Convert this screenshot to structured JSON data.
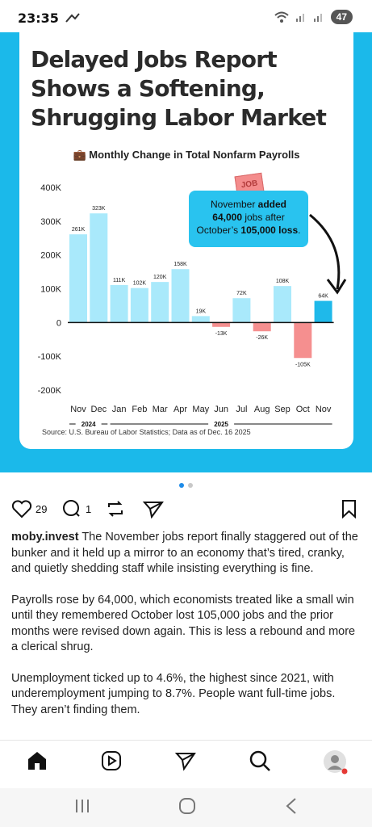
{
  "status_bar": {
    "time": "23:35",
    "battery": "47"
  },
  "post_image": {
    "headline": "Delayed Jobs Report Shows a Softening, Shrugging Labor Market",
    "subtitle": "Monthly Change in Total Nonfarm Payrolls",
    "callout": {
      "line1": "November",
      "bold1": "added",
      "bold2": "64,000",
      "line2": "jobs after",
      "line3": "October’s",
      "bold3": "105,000 loss",
      "end": "."
    },
    "tag": "JOB",
    "source": "Source: U.S. Bureau of Labor Statistics; Data as of Dec. 16 2025"
  },
  "chart_data": {
    "type": "bar",
    "title": "Monthly Change in Total Nonfarm Payrolls",
    "categories": [
      "Nov",
      "Dec",
      "Jan",
      "Feb",
      "Mar",
      "Apr",
      "May",
      "Jun",
      "Jul",
      "Aug",
      "Sep",
      "Oct",
      "Nov"
    ],
    "year_groups": [
      {
        "label": "2024",
        "from": 0,
        "to": 1
      },
      {
        "label": "2025",
        "from": 2,
        "to": 12
      }
    ],
    "values": [
      261,
      323,
      111,
      102,
      120,
      158,
      19,
      -13,
      72,
      -26,
      108,
      -105,
      64
    ],
    "labels": [
      "261K",
      "323K",
      "111K",
      "102K",
      "120K",
      "158K",
      "19K",
      "-13K",
      "72K",
      "-26K",
      "108K",
      "-105K",
      "64K"
    ],
    "ylim": [
      -200,
      400
    ],
    "yticks": [
      400,
      300,
      200,
      100,
      0,
      -100,
      -200
    ],
    "ytick_labels": [
      "400K",
      "300K",
      "200K",
      "100K",
      "0",
      "-100K",
      "-200K"
    ],
    "xlabel": "",
    "ylabel": "",
    "colors": {
      "positive": "#a9e9fb",
      "negative": "#f58f8f",
      "highlight": "#1fb9ea"
    }
  },
  "actions": {
    "likes": "29",
    "comments": "1"
  },
  "post": {
    "username": "moby.invest",
    "para1": "The November jobs report finally staggered out of the bunker and it held up a mirror to an economy that’s tired, cranky, and quietly shedding staff while insisting everything is fine.",
    "para2": "Payrolls rose by 64,000, which economists treated like a small win until they remembered October lost 105,000 jobs and the prior months were revised down again. This is less a rebound and more a clerical shrug.",
    "para3": "Unemployment ticked up to 4.6%, the highest since 2021, with underemployment jumping to 8.7%. People want full-time jobs. They aren’t finding them."
  }
}
